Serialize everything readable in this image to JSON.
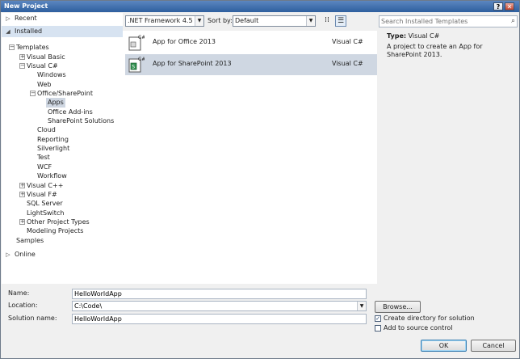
{
  "window": {
    "title": "New Project",
    "help": "?",
    "close": "✕"
  },
  "sidebar": {
    "recent": "Recent",
    "installed": "Installed",
    "online": "Online",
    "tree": {
      "templates": "Templates",
      "visual_basic": "Visual Basic",
      "visual_csharp": "Visual C#",
      "windows": "Windows",
      "web": "Web",
      "office_sharepoint": "Office/SharePoint",
      "apps": "Apps",
      "office_addins": "Office Add-ins",
      "sharepoint_solutions": "SharePoint Solutions",
      "cloud": "Cloud",
      "reporting": "Reporting",
      "silverlight": "Silverlight",
      "test": "Test",
      "wcf": "WCF",
      "workflow": "Workflow",
      "visual_cpp": "Visual C++",
      "visual_fsharp": "Visual F#",
      "sql_server": "SQL Server",
      "lightswitch": "LightSwitch",
      "other_project_types": "Other Project Types",
      "modeling_projects": "Modeling Projects",
      "samples": "Samples"
    }
  },
  "toolbar": {
    "framework": ".NET Framework 4.5",
    "sort_label": "Sort by:",
    "sort_value": "Default"
  },
  "templates": [
    {
      "name": "App for Office 2013",
      "lang": "Visual C#"
    },
    {
      "name": "App for SharePoint 2013",
      "lang": "Visual C#"
    }
  ],
  "search": {
    "placeholder": "Search Installed Templates"
  },
  "details": {
    "type_label": "Type:",
    "type_value": "Visual C#",
    "description": "A project to create an App for SharePoint 2013."
  },
  "form": {
    "name_label": "Name:",
    "name_value": "HelloWorldApp",
    "location_label": "Location:",
    "location_value": "C:\\Code\\",
    "solution_label": "Solution name:",
    "solution_value": "HelloWorldApp",
    "browse": "Browse...",
    "create_directory": "Create directory for solution",
    "add_source_control": "Add to source control",
    "ok": "OK",
    "cancel": "Cancel"
  }
}
